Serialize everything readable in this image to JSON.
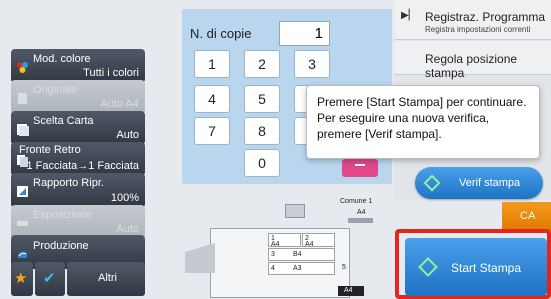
{
  "left_panel": {
    "color_mode": {
      "title": "Mod. colore",
      "value": "Tutti i colori"
    },
    "original": {
      "title": "Originale",
      "value": "Auto A4"
    },
    "paper_select": {
      "title": "Scelta Carta",
      "value": "Auto"
    },
    "duplex": {
      "title": "Fronte Retro",
      "value": "1 Facciata→1 Facciata"
    },
    "ratio": {
      "title": "Rapporto Ripr.",
      "value": "100%"
    },
    "exposure": {
      "title": "Esposizione",
      "value": "Auto"
    },
    "output": {
      "title": "Produzione"
    },
    "others_label": "Altri"
  },
  "copies": {
    "label": "N. di copie",
    "value": "1"
  },
  "keypad": {
    "keys": [
      "1",
      "2",
      "3",
      "4",
      "5",
      "6",
      "7",
      "8",
      "9",
      "0"
    ]
  },
  "right_panel": {
    "register_program": "Registraz. Programma",
    "register_program_sub": "Registra impostazioni correnti",
    "stamp_position": "Regola posizione stampa"
  },
  "tooltip": {
    "line1": "Premere [Start Stampa] per continuare.",
    "line2": "Per eseguire una nuova verifica,",
    "line3": "premere [Verif stampa]."
  },
  "verify_label": "Verif stampa",
  "ca_label": "CA",
  "start_label": "Start Stampa",
  "machine": {
    "bypass_label": "Comune 1",
    "bypass_size": "A4",
    "trays": [
      {
        "num": "1",
        "size": "A4"
      },
      {
        "num": "2",
        "size": "A4"
      },
      {
        "num": "3",
        "size": "B4"
      },
      {
        "num": "4",
        "size": "A3"
      }
    ],
    "tray5": "5",
    "output_size": "A4"
  },
  "colors": {
    "accent_blue": "#2f86d8",
    "alert_red": "#e2261c",
    "panel_blue": "#b9d6ee"
  }
}
